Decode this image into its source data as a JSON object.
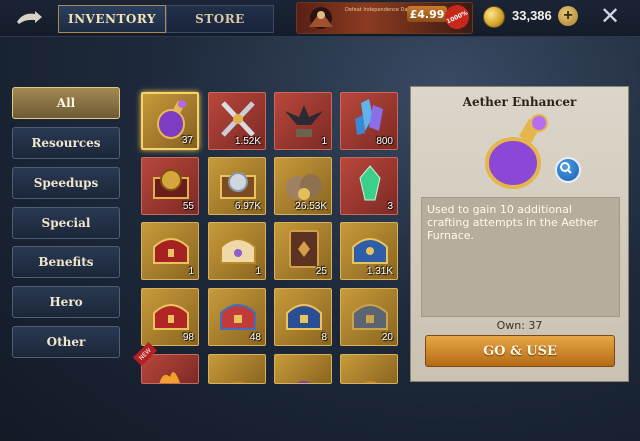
{
  "header": {
    "tabs": [
      {
        "label": "INVENTORY",
        "active": true
      },
      {
        "label": "STORE",
        "active": false
      }
    ],
    "offer": {
      "pack_text": "Defeat Independence Day Pack",
      "price": "£4.99",
      "badge": "1000%"
    },
    "gold": {
      "amount": "33,386",
      "icon": "gold-coin-icon"
    },
    "close_icon": "close-icon",
    "back_icon": "back-icon"
  },
  "categories": [
    {
      "label": "All",
      "active": true
    },
    {
      "label": "Resources"
    },
    {
      "label": "Speedups"
    },
    {
      "label": "Special"
    },
    {
      "label": "Benefits"
    },
    {
      "label": "Hero"
    },
    {
      "label": "Other"
    }
  ],
  "items": [
    {
      "qty": "37",
      "icon": "aether-potion-icon",
      "selected": true
    },
    {
      "qty": "1.52K",
      "icon": "crossed-swords-icon"
    },
    {
      "qty": "1",
      "icon": "dragon-statue-icon"
    },
    {
      "qty": "800",
      "icon": "crystals-icon"
    },
    {
      "qty": "55",
      "icon": "emblem-chest-icon"
    },
    {
      "qty": "6.97K",
      "icon": "medal-chest-icon"
    },
    {
      "qty": "26.53K",
      "icon": "resource-bags-icon"
    },
    {
      "qty": "3",
      "icon": "green-gem-icon"
    },
    {
      "qty": "1",
      "icon": "red-chest-icon"
    },
    {
      "qty": "1",
      "icon": "gold-chest-icon"
    },
    {
      "qty": "25",
      "icon": "book-icon"
    },
    {
      "qty": "1.31K",
      "icon": "blue-chest-icon"
    },
    {
      "qty": "98",
      "icon": "red-chest-icon"
    },
    {
      "qty": "48",
      "icon": "ornate-chest-icon"
    },
    {
      "qty": "8",
      "icon": "blue-gold-chest-icon"
    },
    {
      "qty": "20",
      "icon": "steel-chest-icon"
    }
  ],
  "new_badge": "NEW",
  "detail": {
    "name": "Aether Enhancer",
    "description": "Used to gain 10 additional crafting attempts in the Aether Furnace.",
    "own": "Own: 37",
    "use_button": "GO & USE"
  }
}
